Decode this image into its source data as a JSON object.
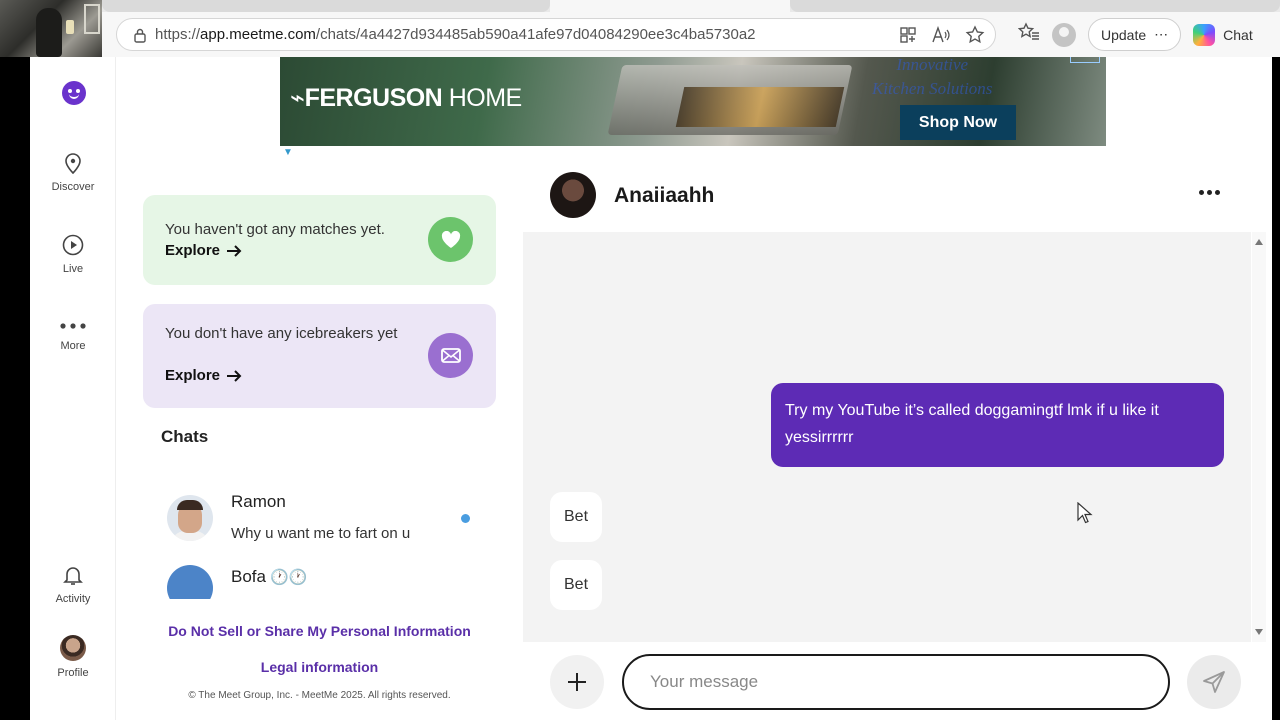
{
  "browser": {
    "url_scheme": "https://",
    "url_host": "app.meetme.com",
    "url_path": "/chats/4a4427d934485ab590a41afe97d04084290ee3c4ba5730a2",
    "update_label": "Update",
    "chat_label": "Chat"
  },
  "nav": {
    "discover": "Discover",
    "live": "Live",
    "more": "More",
    "activity": "Activity",
    "profile": "Profile"
  },
  "ad": {
    "brand_bold": "FERGUSON",
    "brand_light": " HOME",
    "tagline_line1": "Innovative",
    "tagline_line2": "Kitchen Solutions",
    "cta": "Shop Now"
  },
  "cards": {
    "matches_text": "You haven't got any matches yet.",
    "matches_link": "Explore",
    "icebreakers_text": "You don't have any icebreakers yet",
    "icebreakers_link": "Explore"
  },
  "chats": {
    "title": "Chats",
    "items": [
      {
        "name": "Ramon",
        "preview": "Why u want me to fart on u",
        "unread": true
      },
      {
        "name": "Bofa",
        "name_emoji": "🕐🕐",
        "preview": ""
      }
    ]
  },
  "footer": {
    "privacy_link": "Do Not Sell or Share My Personal Information",
    "legal_link": "Legal information",
    "copyright": "© The Meet Group, Inc. - MeetMe 2025. All rights reserved."
  },
  "conversation": {
    "name": "Anaiiaahh",
    "messages": [
      {
        "direction": "out",
        "text": "Try my YouTube it’s called doggamingtf lmk if u like it yessirrrrrr"
      },
      {
        "direction": "in",
        "text": "Bet"
      },
      {
        "direction": "in",
        "text": "Bet"
      }
    ]
  },
  "composer": {
    "placeholder": "Your message"
  },
  "colors": {
    "brand_purple": "#5d2bb5",
    "match_card_bg": "#e6f6e6",
    "match_circle": "#6cc46c",
    "icebreaker_card_bg": "#ece6f6",
    "icebreaker_circle": "#9a6fd0",
    "unread_dot": "#4a9de0"
  }
}
